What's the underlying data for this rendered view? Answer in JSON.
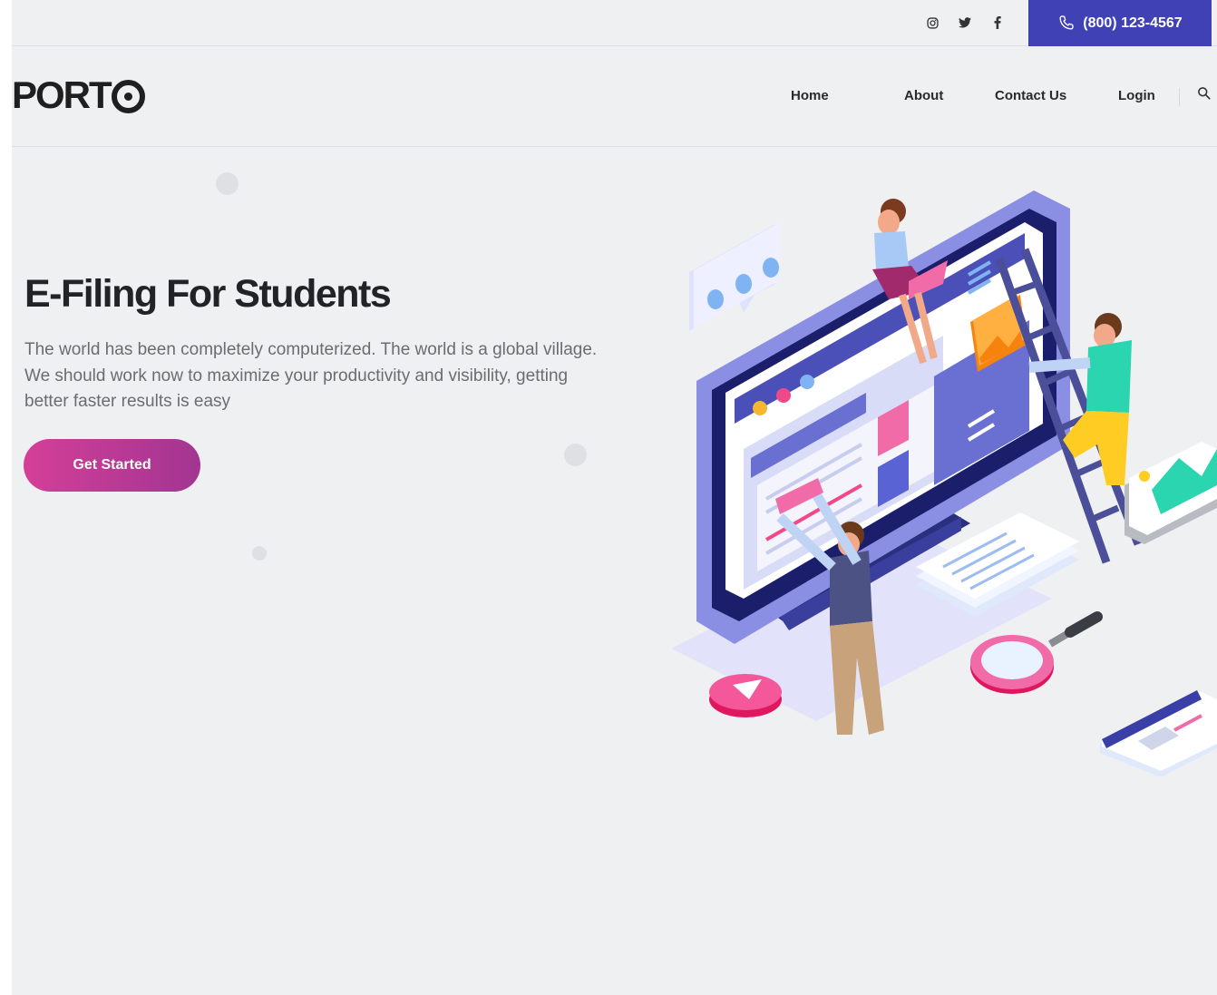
{
  "topbar": {
    "social_icons": [
      "instagram-icon",
      "twitter-icon",
      "facebook-icon"
    ],
    "phone": "(800) 123-4567",
    "phone_icon": "phone-icon"
  },
  "header": {
    "logo_text": "PORT",
    "nav": [
      "Home",
      "About",
      "Contact Us",
      "Login"
    ],
    "search_icon": "search-icon"
  },
  "hero": {
    "title": "E-Filing For Students",
    "text": "The world has been completely computerized. The world is a global village. We should work now to maximize your productivity and visibility, getting better faster results is easy",
    "cta": "Get Started"
  },
  "colors": {
    "accent": "#3f41b5",
    "cta_start": "#d43f98",
    "cta_end": "#a23591",
    "background": "#eff0f2"
  }
}
